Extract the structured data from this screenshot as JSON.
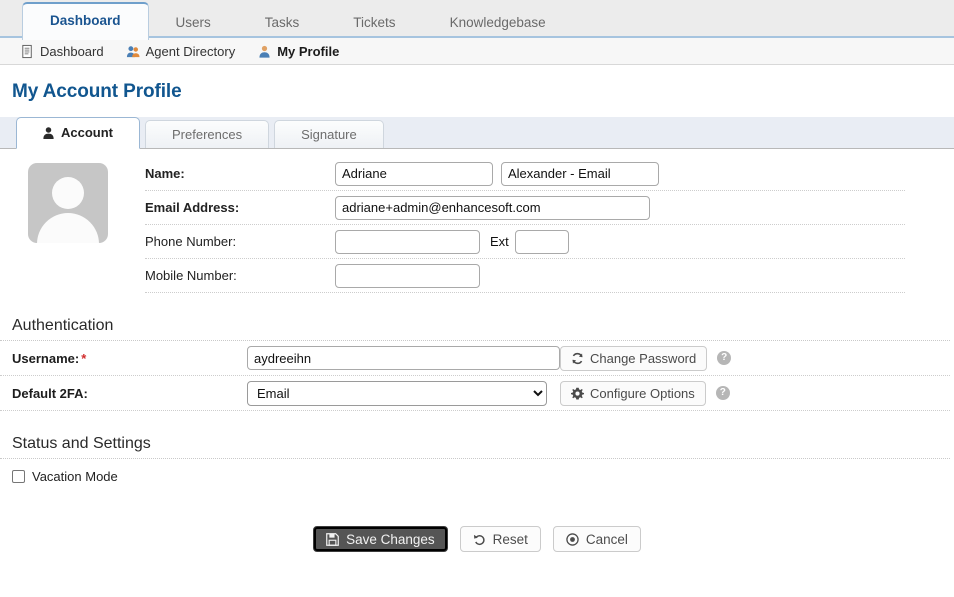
{
  "main_nav": {
    "tabs": [
      {
        "label": "Dashboard",
        "active": true
      },
      {
        "label": "Users",
        "active": false
      },
      {
        "label": "Tasks",
        "active": false
      },
      {
        "label": "Tickets",
        "active": false
      },
      {
        "label": "Knowledgebase",
        "active": false
      }
    ]
  },
  "sub_nav": {
    "items": [
      {
        "label": "Dashboard",
        "icon": "document-icon",
        "current": false
      },
      {
        "label": "Agent Directory",
        "icon": "users-group-icon",
        "current": false
      },
      {
        "label": "My Profile",
        "icon": "user-icon",
        "current": true
      }
    ]
  },
  "page": {
    "title": "My Account Profile",
    "title_color": "#11568f"
  },
  "sub_tabs": [
    {
      "label": "Account",
      "icon": "person-icon",
      "active": true
    },
    {
      "label": "Preferences",
      "icon": "",
      "active": false
    },
    {
      "label": "Signature",
      "icon": "",
      "active": false
    }
  ],
  "avatar": {
    "alt": "profile-photo-placeholder"
  },
  "account_form": {
    "rows": [
      {
        "label": "Name:",
        "bold": true,
        "first_name": "Adriane",
        "last_name": "Alexander - Email",
        "first_placeholder": "",
        "last_placeholder": ""
      },
      {
        "label": "Email Address:",
        "bold": true,
        "email": "adriane+admin@enhancesoft.com",
        "email_placeholder": ""
      },
      {
        "label": "Phone Number:",
        "bold": false,
        "phone": "",
        "phone_placeholder": "",
        "ext_label": "Ext",
        "ext": "",
        "ext_placeholder": ""
      },
      {
        "label": "Mobile Number:",
        "bold": false,
        "mobile": "",
        "mobile_placeholder": ""
      }
    ]
  },
  "authentication": {
    "heading": "Authentication",
    "username_label": "Username:",
    "username_required": "*",
    "username_value": "aydreeihn",
    "change_password_label": "Change Password",
    "change_password_icon": "refresh-icon",
    "username_help": "?",
    "twofa_label": "Default 2FA:",
    "twofa_selected": "Email",
    "twofa_options": [
      "Email"
    ],
    "configure_options_label": "Configure Options",
    "configure_options_icon": "gear-icon",
    "twofa_help": "?"
  },
  "status_settings": {
    "heading": "Status and Settings",
    "vacation_mode_label": "Vacation Mode",
    "vacation_mode_checked": false
  },
  "footer_buttons": {
    "save": {
      "label": "Save Changes",
      "icon": "save-icon"
    },
    "reset": {
      "label": "Reset",
      "icon": "undo-icon"
    },
    "cancel": {
      "label": "Cancel",
      "icon": "cancel-icon"
    }
  }
}
